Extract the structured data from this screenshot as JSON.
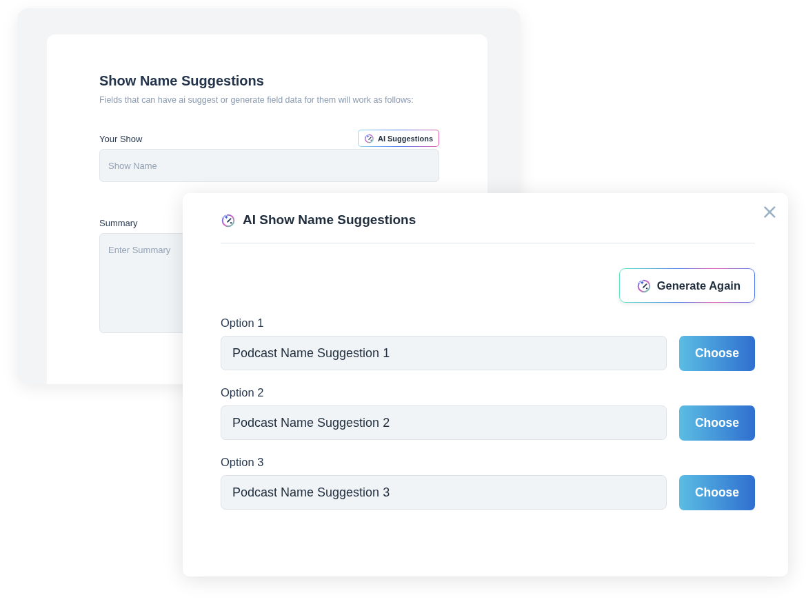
{
  "form": {
    "title": "Show Name Suggestions",
    "subtitle": "Fields that can have ai suggest or generate field data for them will work as follows:",
    "fields": [
      {
        "label": "Your Show",
        "placeholder": "Show Name",
        "kind": "input",
        "ai_button": "AI Suggestions"
      },
      {
        "label": "Summary",
        "placeholder": "Enter Summary",
        "kind": "textarea"
      }
    ]
  },
  "dialog": {
    "title": "AI Show Name Suggestions",
    "close": "×",
    "generate_button": "Generate Again",
    "options": [
      {
        "label": "Option 1",
        "value": "Podcast Name Suggestion 1",
        "button": "Choose"
      },
      {
        "label": "Option 2",
        "value": "Podcast Name Suggestion 2",
        "button": "Choose"
      },
      {
        "label": "Option 3",
        "value": "Podcast Name Suggestion 3",
        "button": "Choose"
      }
    ]
  }
}
